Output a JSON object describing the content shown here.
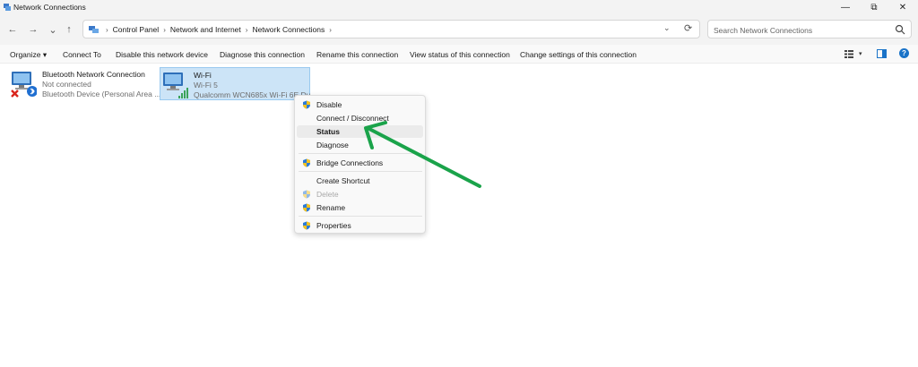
{
  "window": {
    "title": "Network Connections",
    "min_glyph": "—",
    "max_glyph": "⧉",
    "close_glyph": "✕"
  },
  "nav": {
    "back": "←",
    "forward": "→",
    "recent": "⌄",
    "up": "↑"
  },
  "address": {
    "crumbs": [
      "Control Panel",
      "Network and Internet",
      "Network Connections"
    ],
    "separator": "›",
    "dropdown": "⌄",
    "refresh": "⟳"
  },
  "search": {
    "placeholder": "Search Network Connections"
  },
  "commands": {
    "organize": "Organize ▾",
    "connect_to": "Connect To",
    "disable": "Disable this network device",
    "diagnose": "Diagnose this connection",
    "rename": "Rename this connection",
    "view_status": "View status of this connection",
    "change_settings": "Change settings of this connection",
    "view_dd": "▾",
    "help": "?"
  },
  "connections": [
    {
      "name": "Bluetooth Network Connection",
      "status": "Not connected",
      "device": "Bluetooth Device (Personal Area ..."
    },
    {
      "name": "Wi-Fi",
      "status": "Wi-Fi 5",
      "device": "Qualcomm WCN685x Wi-Fi 6E Du..."
    }
  ],
  "context_menu": {
    "items": [
      {
        "label": "Disable"
      },
      {
        "label": "Connect / Disconnect"
      },
      {
        "label": "Status"
      },
      {
        "label": "Diagnose"
      },
      {
        "label": "Bridge Connections"
      },
      {
        "label": "Create Shortcut"
      },
      {
        "label": "Delete"
      },
      {
        "label": "Rename"
      },
      {
        "label": "Properties"
      }
    ]
  },
  "colors": {
    "accent": "#1a73c8",
    "selection": "#cce4f7",
    "annotation_arrow": "#1aa34a"
  }
}
